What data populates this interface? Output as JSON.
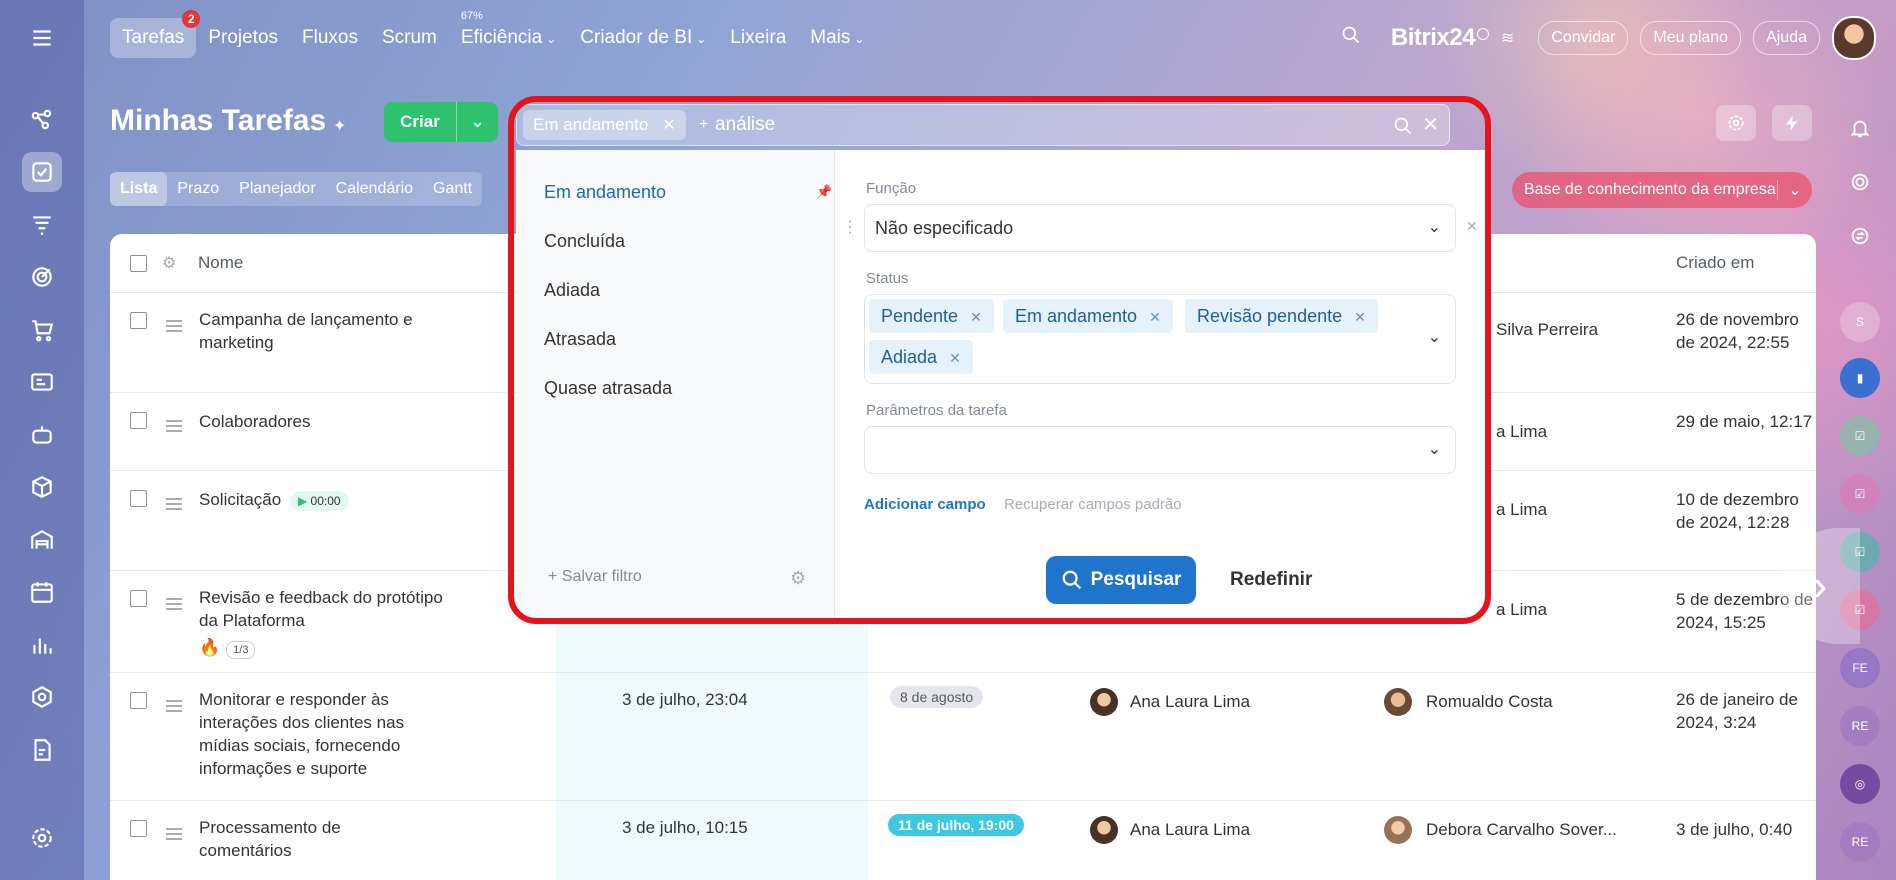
{
  "nav": {
    "items": [
      {
        "label": "Tarefas",
        "badge": "2"
      },
      {
        "label": "Projetos"
      },
      {
        "label": "Fluxos"
      },
      {
        "label": "Scrum"
      },
      {
        "label": "Eficiência",
        "pct": "67%",
        "dropdown": true
      },
      {
        "label": "Criador de BI",
        "dropdown": true
      },
      {
        "label": "Lixeira"
      },
      {
        "label": "Mais",
        "dropdown": true
      }
    ],
    "brand": "Bitrix24",
    "invite": "Convidar",
    "plan": "Meu plano",
    "help": "Ajuda"
  },
  "page": {
    "title": "Minhas Tarefas",
    "create_label": "Criar",
    "views": [
      "Lista",
      "Prazo",
      "Planejador",
      "Calendário",
      "Gantt"
    ],
    "kb_label": "Base de conhecimento da empresa"
  },
  "table": {
    "columns": {
      "name": "Nome",
      "created": "Criado em"
    },
    "rows": [
      {
        "name": "Campanha de lançamento e marketing",
        "responsible": "Silva Perreira",
        "created": "26 de novembro de 2024, 22:55"
      },
      {
        "name": "Colaboradores",
        "responsible": "a Lima",
        "created": "29 de maio, 12:17"
      },
      {
        "name": "Solicitação",
        "timer": "00:00",
        "responsible": "a Lima",
        "created": "10 de dezembro de 2024, 12:28"
      },
      {
        "name": "Revisão e feedback do protótipo da Plataforma",
        "subtasks": "1/3",
        "responsible": "a Lima",
        "created": "5 de dezembro de 2024, 15:25"
      },
      {
        "name": "Monitorar e responder às interações dos clientes nas mídias sociais, fornecendo informações e suporte",
        "activity": "3 de julho, 23:04",
        "deadline": "8 de agosto",
        "creator": "Ana Laura Lima",
        "responsible": "Romualdo Costa",
        "created": "26 de janeiro de 2024, 3:24"
      },
      {
        "name": "Processamento de comentários",
        "activity": "3 de julho, 10:15",
        "deadline": "11 de julho, 19:00",
        "creator": "Ana Laura Lima",
        "responsible": "Debora Carvalho Sover...",
        "created": "3 de julho, 0:40"
      }
    ]
  },
  "filter": {
    "active_chip": "Em andamento",
    "search_text": "análise",
    "presets": [
      "Em andamento",
      "Concluída",
      "Adiada",
      "Atrasada",
      "Quase atrasada"
    ],
    "save_filter": "Salvar filtro",
    "fields": {
      "role_label": "Função",
      "role_value": "Não especificado",
      "status_label": "Status",
      "status_chips": [
        "Pendente",
        "Em andamento",
        "Revisão pendente",
        "Adiada"
      ],
      "params_label": "Parâmetros da tarefa",
      "params_value": ""
    },
    "add_field": "Adicionar campo",
    "restore_fields": "Recuperar campos padrão",
    "search_button": "Pesquisar",
    "reset_button": "Redefinir"
  },
  "right_rail": {
    "avatars": [
      "S",
      "FE",
      "RE",
      "RE"
    ]
  },
  "colors": {
    "accent": "#1f75cb",
    "create_green": "#2fc26e",
    "highlight_red": "#e5141c",
    "chip_bg": "#e5f2fc",
    "deadline_teal": "#3bc8e0"
  }
}
